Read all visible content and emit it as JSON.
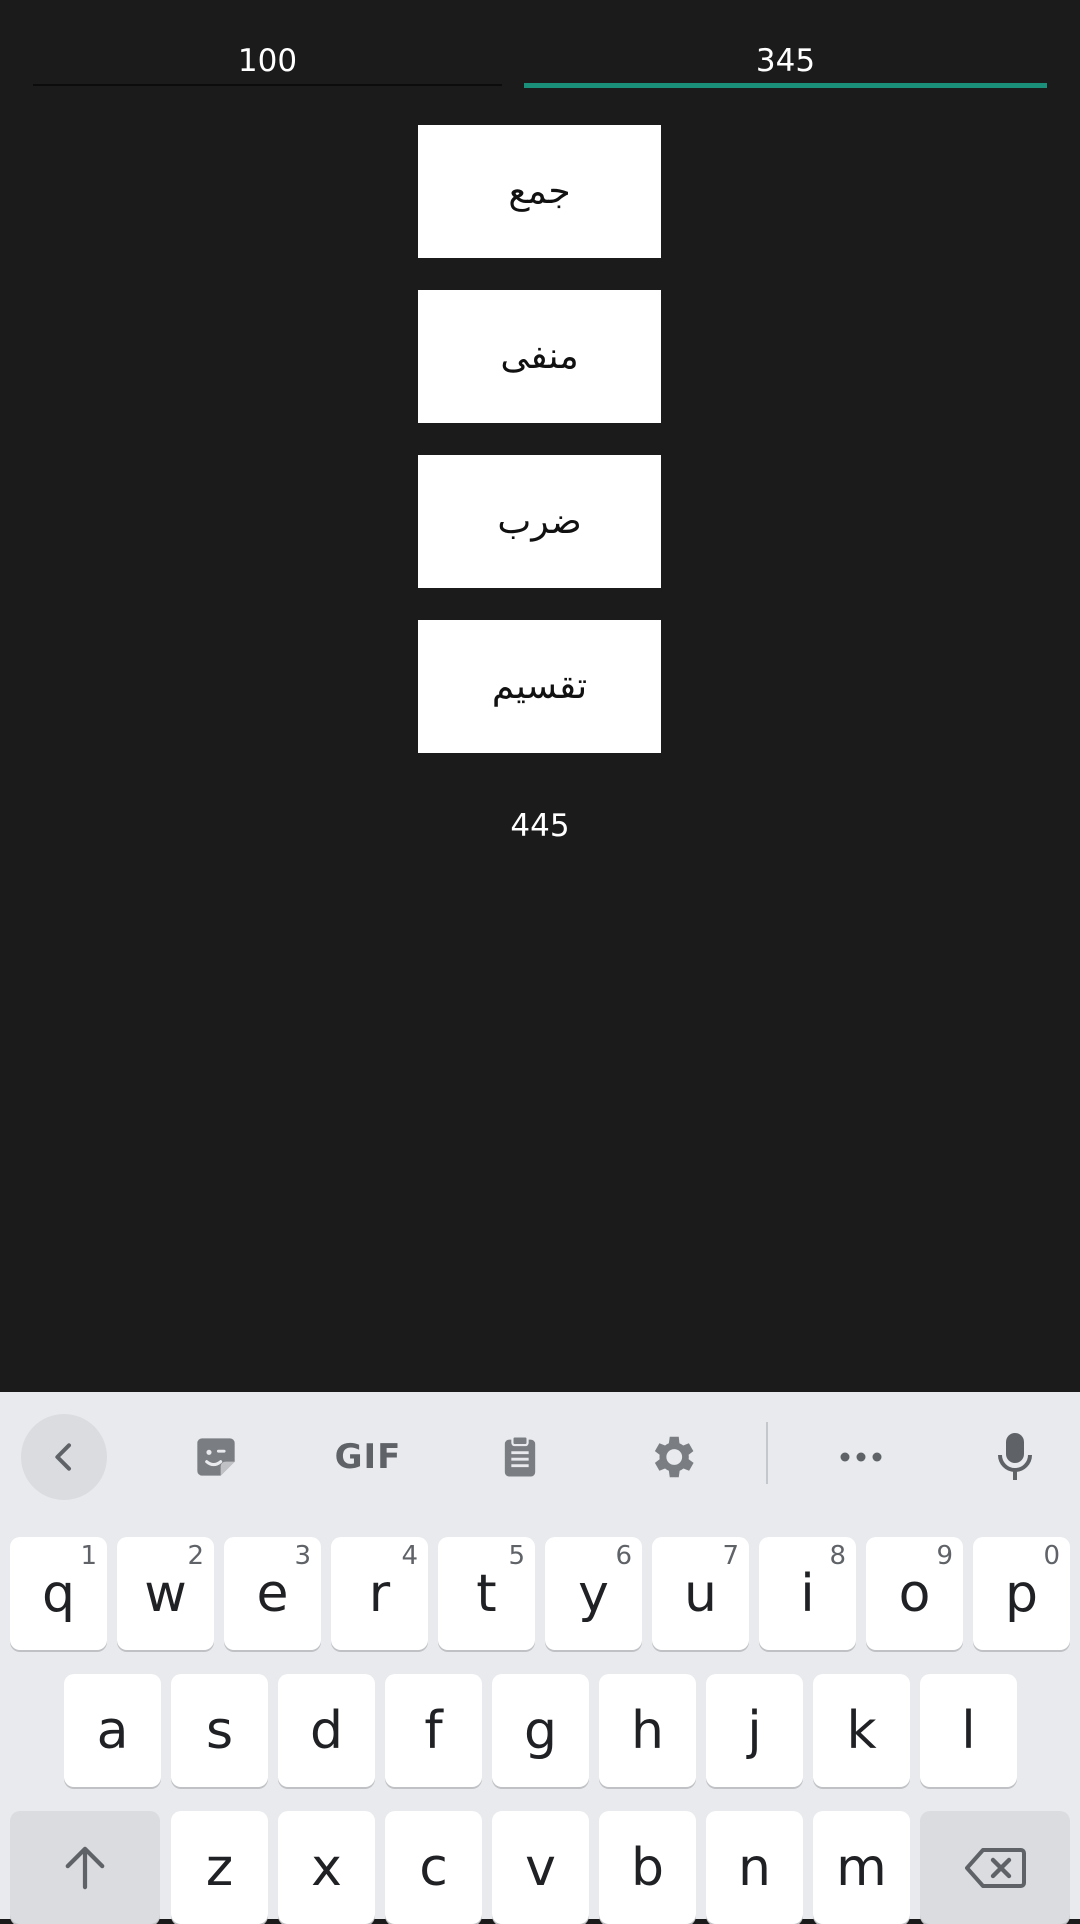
{
  "inputs": {
    "first_value": "100",
    "second_value": "345"
  },
  "buttons": {
    "add": "جمع",
    "subtract": "منفی",
    "multiply": "ضرب",
    "divide": "تقسیم"
  },
  "result": "445",
  "colors": {
    "background": "#1b1b1b",
    "accent": "#1a8f7a",
    "keyboard_bg": "#e8eaed"
  },
  "keyboard": {
    "toolbar": {
      "back_icon": "chevron-left-icon",
      "sticker_icon": "sticker-icon",
      "gif_label": "GIF",
      "clipboard_icon": "clipboard-icon",
      "settings_icon": "gear-icon",
      "more_icon": "more-horizontal-icon",
      "mic_icon": "microphone-icon"
    },
    "row1": [
      {
        "key": "q",
        "hint": "1"
      },
      {
        "key": "w",
        "hint": "2"
      },
      {
        "key": "e",
        "hint": "3"
      },
      {
        "key": "r",
        "hint": "4"
      },
      {
        "key": "t",
        "hint": "5"
      },
      {
        "key": "y",
        "hint": "6"
      },
      {
        "key": "u",
        "hint": "7"
      },
      {
        "key": "i",
        "hint": "8"
      },
      {
        "key": "o",
        "hint": "9"
      },
      {
        "key": "p",
        "hint": "0"
      }
    ],
    "row2": [
      "a",
      "s",
      "d",
      "f",
      "g",
      "h",
      "j",
      "k",
      "l"
    ],
    "row3": [
      "z",
      "x",
      "c",
      "v",
      "b",
      "n",
      "m"
    ]
  }
}
